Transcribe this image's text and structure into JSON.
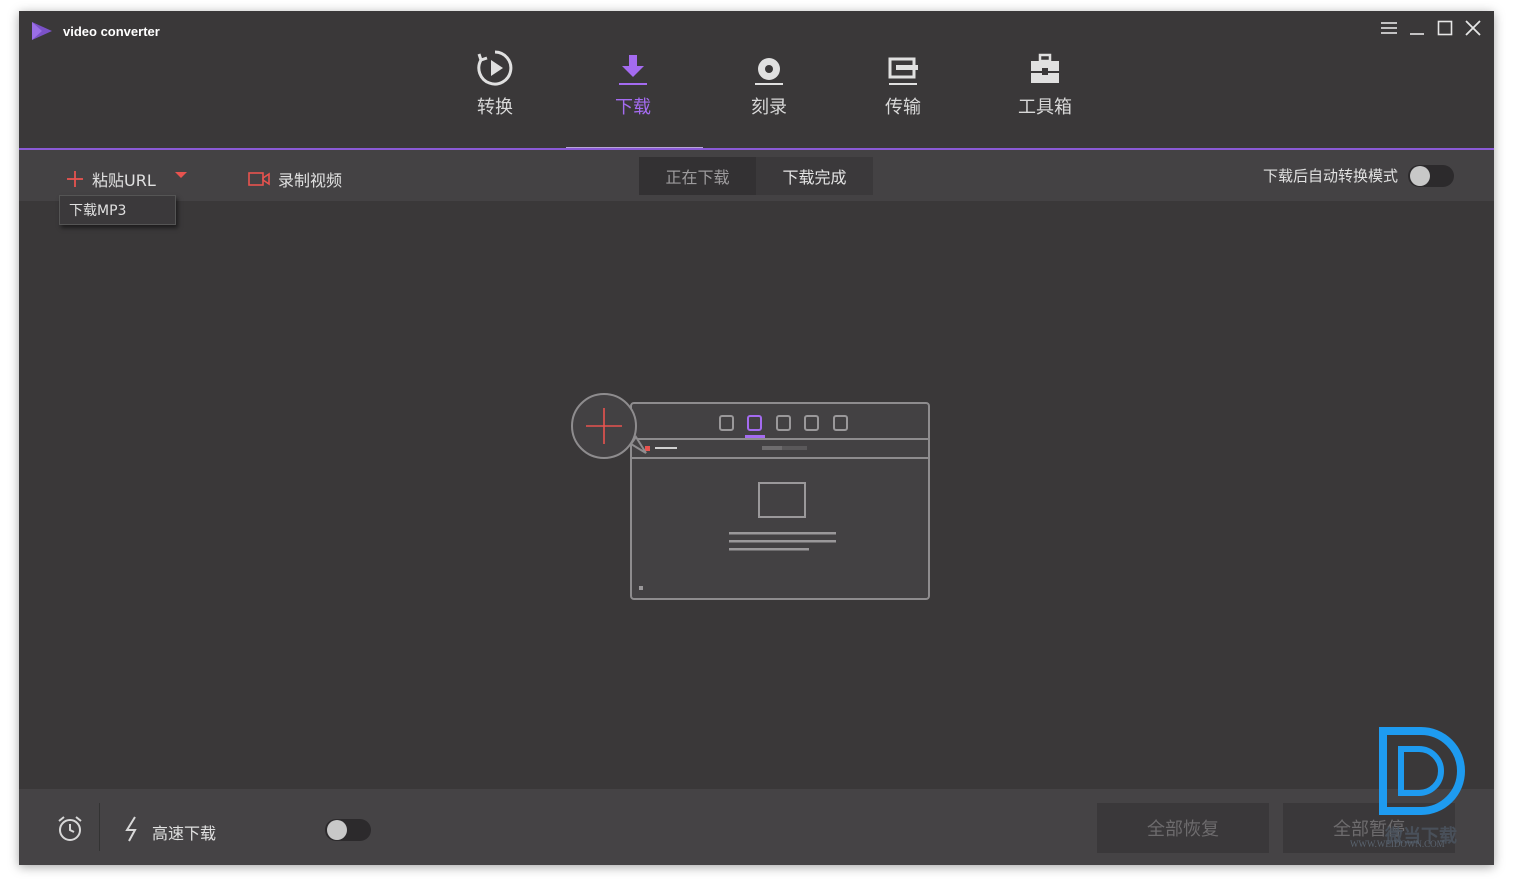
{
  "app": {
    "title": "video converter"
  },
  "nav": {
    "items": [
      {
        "label": "转换",
        "icon": "convert-play-icon"
      },
      {
        "label": "下载",
        "icon": "download-arrow-icon",
        "active": true
      },
      {
        "label": "刻录",
        "icon": "burn-disc-icon"
      },
      {
        "label": "传输",
        "icon": "transfer-icon"
      },
      {
        "label": "工具箱",
        "icon": "toolbox-icon"
      }
    ]
  },
  "toolbar": {
    "paste_url_label": "粘贴URL",
    "record_label": "录制视频",
    "tabs": [
      "正在下载",
      "下载完成"
    ],
    "auto_convert_label": "下载后自动转换模式",
    "dropdown_item": "下载MP3"
  },
  "bottom": {
    "high_speed_label": "高速下载",
    "resume_all_label": "全部恢复",
    "pause_all_label": "全部暂停"
  },
  "watermark": {
    "text": "微当下载",
    "url": "WWW.WEIDOWN.COM"
  },
  "colors": {
    "accent": "#a46bf0",
    "red": "#e8534f",
    "background": "#3a3839",
    "watermark_blue": "#1e9bf0"
  }
}
